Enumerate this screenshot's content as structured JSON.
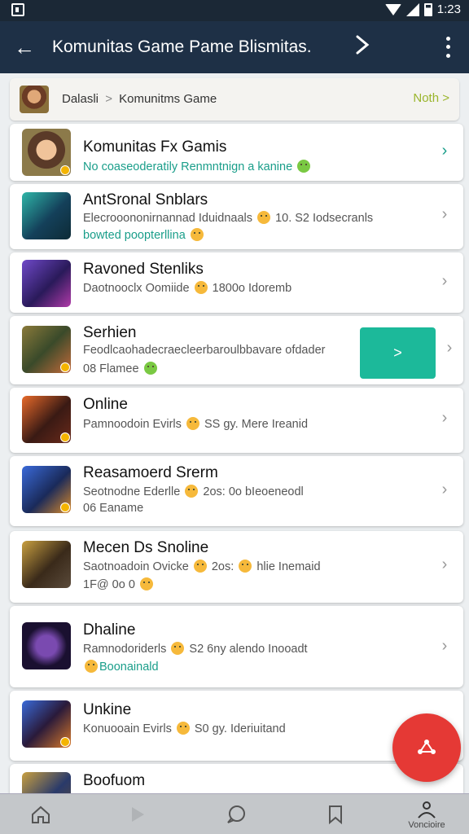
{
  "status_bar": {
    "time": "1:23",
    "icons": [
      "notification-icon",
      "wifi-icon",
      "signal-icon",
      "battery-icon"
    ]
  },
  "app_bar": {
    "title": "Komunitas Game Pame Blismitas.",
    "back_icon": "arrow-left-icon",
    "share_icon": "share-icon",
    "more_icon": "more-vert-icon"
  },
  "breadcrumb": {
    "parent": "Dalasli",
    "separator": ">",
    "current": "Komunitms Game",
    "action": "Noth >"
  },
  "featured": {
    "title": "Komunitas Fx Gamis",
    "subtitle": "No coaseoderatily Renmntnign a kanine"
  },
  "join_button": {
    "label": ">"
  },
  "cards": [
    {
      "title": "AntSronal Snblars",
      "line1": "Elecrooononirnannad Iduidnaals",
      "line1b": "10. S2 Iodsecranls",
      "line2": "bowted poopterllina"
    },
    {
      "title": "Ravoned Stenliks",
      "line1": "Daotnooclx Oomiide",
      "line1b": "1800o Idoremb",
      "line2": ""
    },
    {
      "title": "Serhien",
      "line1": "Feodlcaohadecraecleerbaroulbbavare ofdader",
      "line1b": "",
      "line2": "08 Flamee"
    },
    {
      "title": "Online",
      "line1": "Pamnoodoin Evirls",
      "line1b": "SS gy. Mere Ireanid",
      "line2": ""
    },
    {
      "title": "Reasamoerd Srerm",
      "line1": "Seotnodne Ederlle",
      "line1b": "2os: 0o bIeoeneodl",
      "line2": "06 Eaname"
    },
    {
      "title": "Mecen Ds Snoline",
      "line1": "Saotnoadoin Ovicke",
      "line1b": "2os:",
      "line1c": "hlie Inemaid",
      "line2": "1F@ 0o 0"
    },
    {
      "title": "Dhaline",
      "line1": "Ramnodoriderls",
      "line1b": "S2 6ny alendo Inooadt",
      "line2": "Boonainald"
    },
    {
      "title": "Unkine",
      "line1": "Konuooain Evirls",
      "line1b": "S0 gy. Ideriuitand",
      "line2": ""
    },
    {
      "title": "Boofuom",
      "line1": "",
      "line1b": "",
      "line2": ""
    }
  ],
  "fab": {
    "icon": "create-post-icon"
  },
  "bottom_nav": {
    "items": [
      {
        "icon": "home-icon",
        "label": ""
      },
      {
        "icon": "play-icon",
        "label": ""
      },
      {
        "icon": "chat-icon",
        "label": ""
      },
      {
        "icon": "bookmark-icon",
        "label": ""
      },
      {
        "icon": "profile-icon",
        "label": "Voncioire"
      }
    ]
  },
  "colors": {
    "app_bar": "#1e3046",
    "status_bar": "#1b2836",
    "accent_teal": "#1cb99a",
    "fab": "#e53935",
    "breadcrumb_action": "#9ab52c"
  }
}
